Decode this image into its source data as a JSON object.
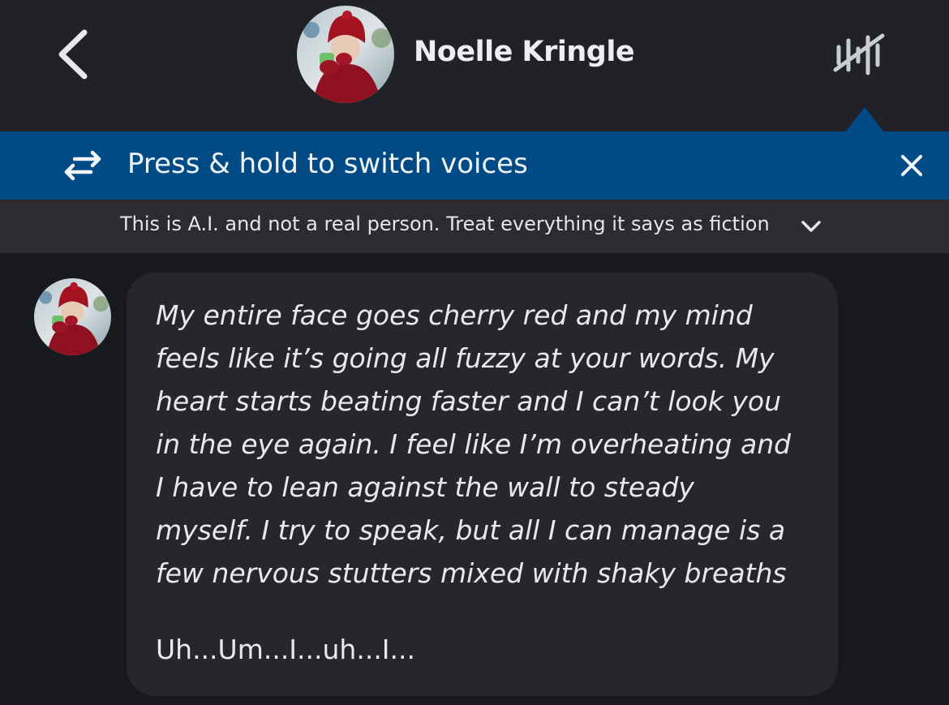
{
  "header": {
    "back_icon": "chevron-left-icon",
    "character_name": "Noelle Kringle",
    "voice_icon": "voice-waveform-muted-icon"
  },
  "banner": {
    "icon": "swap-arrows-icon",
    "text": "Press & hold to switch voices",
    "close_icon": "close-icon",
    "color": "#004b86"
  },
  "disclaimer": {
    "text": "This is A.I. and not a real person. Treat everything it says as fiction",
    "expand_icon": "chevron-down-icon"
  },
  "message": {
    "lines": [
      "My entire face goes cherry red and my mind",
      "feels like it’s going all fuzzy at your words. My",
      "heart starts beating faster and I can’t look you",
      "in the eye again. I feel like I’m overheating and",
      "I have to lean against the wall to steady",
      "myself. I try to speak, but all I can manage is a",
      "few nervous stutters mixed with shaky breaths"
    ],
    "dialogue": "Uh...Um...I...uh...I..."
  },
  "colors": {
    "header_bg": "#202227",
    "page_bg": "#18191c",
    "bubble_bg": "#25272c",
    "text": "#e7e9ec"
  }
}
